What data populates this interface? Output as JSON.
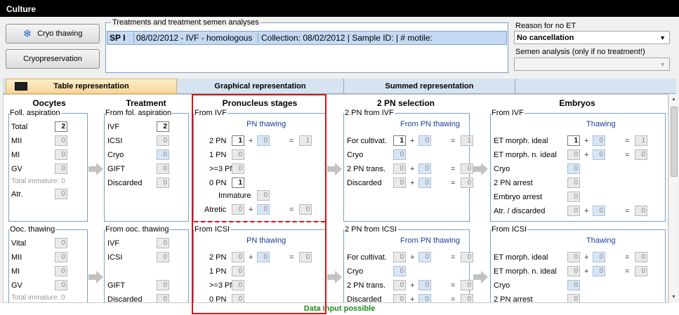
{
  "window": {
    "title": "Culture"
  },
  "left_buttons": {
    "cryo_thawing": "Cryo thawing",
    "cryopreservation": "Cryopreservation"
  },
  "treatments": {
    "group_label": "Treatments and treatment semen analyses",
    "row": {
      "code": "SP I",
      "date": "08/02/2012 - IVF - homologous",
      "details": "Collection: 08/02/2012 | Sample ID:  | # motile:"
    }
  },
  "reason": {
    "label": "Reason for no ET",
    "value": "No cancellation",
    "semen_label": "Semen analysis (only if no treatment!)",
    "semen_value": ""
  },
  "tabs": [
    "Table representation",
    "Graphical representation",
    "Summed representation"
  ],
  "sections": {
    "oocytes": "Oocytes",
    "treatment": "Treatment",
    "pronucleus": "Pronucleus stages",
    "pn_selection": "2 PN selection",
    "embryos": "Embryos"
  },
  "ivf": {
    "oocytes": {
      "title": "Foll. aspiration",
      "rows": [
        {
          "label": "Total",
          "value": "2"
        },
        {
          "label": "MII",
          "value": "0"
        },
        {
          "label": "MI",
          "value": "0"
        },
        {
          "label": "GV",
          "value": "0"
        }
      ],
      "total_immature": "Total immature: 0",
      "atr": {
        "label": "Atr.",
        "value": "0"
      }
    },
    "treatment": {
      "title": "From fol. aspiration",
      "rows": [
        {
          "label": "IVF",
          "value": "2"
        },
        {
          "label": "ICSI",
          "value": "0"
        },
        {
          "label": "Cryo",
          "value": "0"
        },
        {
          "label": "GIFT",
          "value": "0"
        },
        {
          "label": "Discarded",
          "value": "0"
        }
      ]
    },
    "pronucleus": {
      "title": "From IVF",
      "sub": "PN thawing",
      "rows": [
        {
          "label": "2 PN",
          "value": "1",
          "thaw": "0",
          "eq": "1"
        },
        {
          "label": "1 PN",
          "value": "0"
        },
        {
          "label": ">=3 PN",
          "value": "0"
        },
        {
          "label": "0 PN",
          "value": "1"
        }
      ],
      "immature": {
        "label": "Immature",
        "value": "0"
      },
      "atretic": {
        "label": "Atretic",
        "value": "0",
        "thaw": "0",
        "eq": "0"
      }
    },
    "pn_selection": {
      "title": "2 PN from IVF",
      "sub": "From PN thawing",
      "rows": [
        {
          "label": "For cultivat.",
          "value": "1",
          "thaw": "0",
          "eq": "1"
        },
        {
          "label": "Cryo",
          "value": "0"
        },
        {
          "label": "2 PN trans.",
          "value": "0",
          "thaw": "0",
          "eq": "0"
        },
        {
          "label": "Discarded",
          "value": "0",
          "thaw": "0",
          "eq": "0"
        }
      ]
    },
    "embryos": {
      "title": "From IVF",
      "sub": "Thawing",
      "rows": [
        {
          "label": "ET morph. ideal",
          "value": "1",
          "thaw": "0",
          "eq": "1"
        },
        {
          "label": "ET morph. n. ideal",
          "value": "0",
          "thaw": "0",
          "eq": "0"
        },
        {
          "label": "Cryo",
          "value": "0"
        },
        {
          "label": "2 PN arrest",
          "value": "0"
        },
        {
          "label": "Embryo arrest",
          "value": "0"
        },
        {
          "label": "Atr. / discarded",
          "value": "0",
          "thaw": "0",
          "eq": "0"
        }
      ]
    }
  },
  "icsi": {
    "oocytes": {
      "title": "Ooc. thawing",
      "rows": [
        {
          "label": "Vital",
          "value": "0"
        },
        {
          "label": "MII",
          "value": "0"
        },
        {
          "label": "MI",
          "value": "0"
        },
        {
          "label": "GV",
          "value": "0"
        }
      ],
      "total_immature": "Total immature: 0"
    },
    "treatment": {
      "title": "From ooc. thawing",
      "rows": [
        {
          "label": "IVF",
          "value": "0"
        },
        {
          "label": "ICSI",
          "value": "0"
        },
        {
          "label": "GIFT",
          "value": "0"
        },
        {
          "label": "Discarded",
          "value": "0"
        }
      ]
    },
    "pronucleus": {
      "title": "From ICSI",
      "sub": "PN thawing",
      "rows": [
        {
          "label": "2 PN",
          "value": "0",
          "thaw": "0",
          "eq": "0"
        },
        {
          "label": "1 PN",
          "value": "0"
        },
        {
          "label": ">=3 PN",
          "value": "0"
        },
        {
          "label": "0 PN",
          "value": "0"
        }
      ]
    },
    "pn_selection": {
      "title": "2 PN from ICSI",
      "sub": "From PN thawing",
      "rows": [
        {
          "label": "For cultivat.",
          "value": "0",
          "thaw": "0",
          "eq": "0"
        },
        {
          "label": "Cryo",
          "value": "0"
        },
        {
          "label": "2 PN trans.",
          "value": "0",
          "thaw": "0",
          "eq": "0"
        },
        {
          "label": "Discarded",
          "value": "0",
          "thaw": "0",
          "eq": "0"
        }
      ]
    },
    "embryos": {
      "title": "From ICSI",
      "sub": "Thawing",
      "rows": [
        {
          "label": "ET morph. ideal",
          "value": "0",
          "thaw": "0",
          "eq": "0"
        },
        {
          "label": "ET morph. n. ideal",
          "value": "0",
          "thaw": "0",
          "eq": "0"
        },
        {
          "label": "Cryo",
          "value": "0"
        },
        {
          "label": "2 PN arrest",
          "value": "0"
        }
      ]
    }
  },
  "status": "Data input possible",
  "colors": {
    "accent": "#1a3d9a",
    "highlight": "#e01010",
    "status": "#1c8a1c"
  }
}
